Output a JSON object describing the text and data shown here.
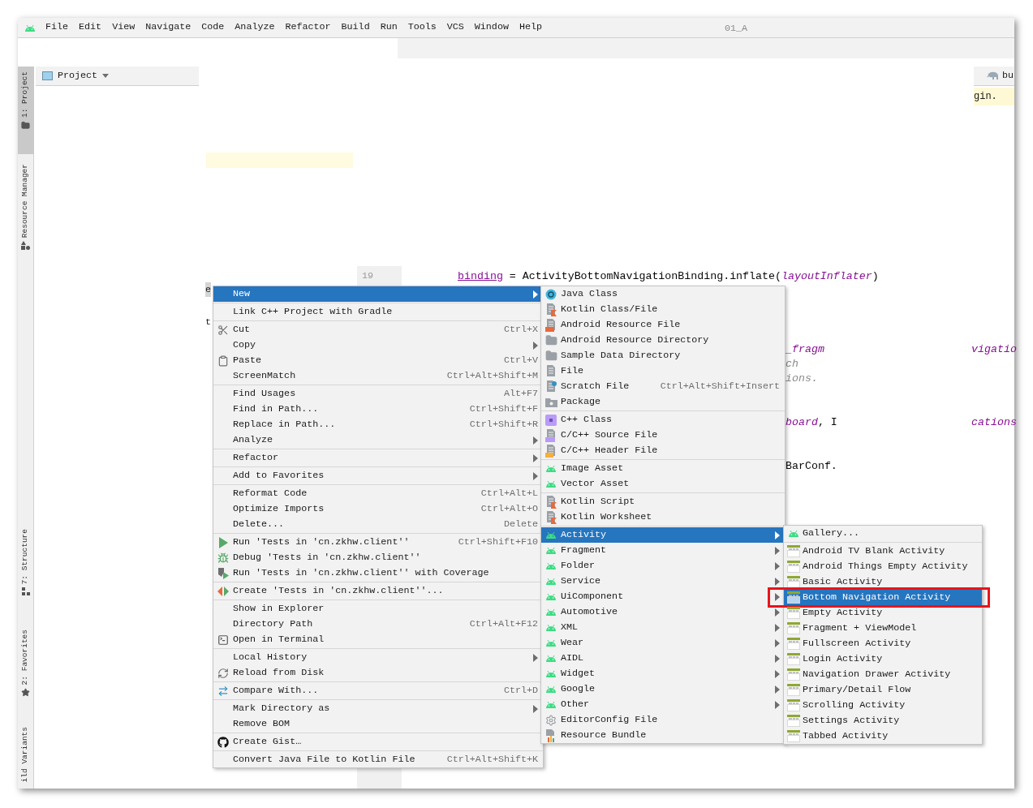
{
  "menu_bar": {
    "items": [
      "File",
      "Edit",
      "View",
      "Navigate",
      "Code",
      "Analyze",
      "Refactor",
      "Build",
      "Run",
      "Tools",
      "VCS",
      "Window",
      "Help"
    ],
    "title_fragment": "01_A"
  },
  "tool_strip": {
    "items": [
      {
        "label": "1: Project",
        "kind": "folder",
        "selected": true
      },
      {
        "label": "Resource Manager",
        "kind": "shapes",
        "selected": false
      },
      {
        "label": "7: Structure",
        "kind": "structure",
        "selected": false
      },
      {
        "label": "2: Favorites",
        "kind": "star",
        "selected": false
      },
      {
        "label": "ild Variants",
        "kind": "none",
        "selected": false
      }
    ]
  },
  "project_panel": {
    "title": "Project",
    "tree_fragments": [
      "e",
      "t"
    ]
  },
  "editor": {
    "tab_fragment": "bu",
    "banner_fragment": "gin.",
    "line_number": "19",
    "code_line": [
      {
        "text": "binding",
        "kind": "property"
      },
      {
        "text": " = ActivityBottomNavigationBinding.inflate(",
        "kind": "plain"
      },
      {
        "text": "layoutInflater",
        "kind": "param"
      },
      {
        "text": ")",
        "kind": "plain"
      }
    ],
    "fragments": [
      [
        {
          "text": "_fragm",
          "kind": "param"
        }
      ],
      [
        {
          "text": "vigatio",
          "kind": "param"
        }
      ],
      [
        {
          "text": "ch",
          "kind": "comment"
        }
      ],
      [
        {
          "text": "ions.",
          "kind": "comment"
        }
      ],
      [
        {
          "text": "board",
          "kind": "param"
        },
        {
          "text": ", I",
          "kind": "plain"
        }
      ],
      [
        {
          "text": "cations",
          "kind": "param"
        }
      ],
      [
        {
          "text": "BarConf.",
          "kind": "plain"
        }
      ]
    ]
  },
  "context_menu": {
    "groups": [
      [
        {
          "label": "New",
          "kind": "none",
          "submenu": true,
          "selected": true
        }
      ],
      [
        {
          "label": "Link C++ Project with Gradle",
          "kind": "none",
          "submenu": false,
          "selected": false
        }
      ],
      [
        {
          "label": "Cut",
          "shortcut": "Ctrl+X",
          "kind": "cut",
          "submenu": false,
          "selected": false
        },
        {
          "label": "Copy",
          "kind": "none",
          "submenu": true,
          "selected": false
        },
        {
          "label": "Paste",
          "shortcut": "Ctrl+V",
          "kind": "paste",
          "submenu": false,
          "selected": false
        },
        {
          "label": "ScreenMatch",
          "shortcut": "Ctrl+Alt+Shift+M",
          "kind": "none",
          "submenu": false,
          "selected": false
        }
      ],
      [
        {
          "label": "Find Usages",
          "shortcut": "Alt+F7",
          "kind": "none",
          "submenu": false,
          "selected": false
        },
        {
          "label": "Find in Path...",
          "shortcut": "Ctrl+Shift+F",
          "kind": "none",
          "submenu": false,
          "selected": false
        },
        {
          "label": "Replace in Path...",
          "shortcut": "Ctrl+Shift+R",
          "kind": "none",
          "submenu": false,
          "selected": false
        },
        {
          "label": "Analyze",
          "kind": "none",
          "submenu": true,
          "selected": false
        }
      ],
      [
        {
          "label": "Refactor",
          "kind": "none",
          "submenu": true,
          "selected": false
        }
      ],
      [
        {
          "label": "Add to Favorites",
          "kind": "none",
          "submenu": true,
          "selected": false
        }
      ],
      [
        {
          "label": "Reformat Code",
          "shortcut": "Ctrl+Alt+L",
          "kind": "none",
          "submenu": false,
          "selected": false
        },
        {
          "label": "Optimize Imports",
          "shortcut": "Ctrl+Alt+O",
          "kind": "none",
          "submenu": false,
          "selected": false
        },
        {
          "label": "Delete...",
          "shortcut": "Delete",
          "kind": "none",
          "submenu": false,
          "selected": false
        }
      ],
      [
        {
          "label": "Run 'Tests in 'cn.zkhw.client''",
          "shortcut": "Ctrl+Shift+F10",
          "kind": "run",
          "submenu": false,
          "selected": false
        },
        {
          "label": "Debug 'Tests in 'cn.zkhw.client''",
          "kind": "debug",
          "submenu": false,
          "selected": false
        },
        {
          "label": "Run 'Tests in 'cn.zkhw.client'' with Coverage",
          "kind": "coverage",
          "submenu": false,
          "selected": false
        }
      ],
      [
        {
          "label": "Create 'Tests in 'cn.zkhw.client''...",
          "kind": "create-test",
          "submenu": false,
          "selected": false
        }
      ],
      [
        {
          "label": "Show in Explorer",
          "kind": "none",
          "submenu": false,
          "selected": false
        },
        {
          "label": "Directory Path",
          "shortcut": "Ctrl+Alt+F12",
          "kind": "none",
          "submenu": false,
          "selected": false
        },
        {
          "label": "Open in Terminal",
          "kind": "terminal",
          "submenu": false,
          "selected": false
        }
      ],
      [
        {
          "label": "Local History",
          "kind": "none",
          "submenu": true,
          "selected": false
        },
        {
          "label": "Reload from Disk",
          "kind": "reload",
          "submenu": false,
          "selected": false
        }
      ],
      [
        {
          "label": "Compare With...",
          "shortcut": "Ctrl+D",
          "kind": "compare",
          "submenu": false,
          "selected": false
        }
      ],
      [
        {
          "label": "Mark Directory as",
          "kind": "none",
          "submenu": true,
          "selected": false
        },
        {
          "label": "Remove BOM",
          "kind": "none",
          "submenu": false,
          "selected": false
        }
      ],
      [
        {
          "label": "Create Gist…",
          "kind": "github",
          "submenu": false,
          "selected": false
        }
      ],
      [
        {
          "label": "Convert Java File to Kotlin File",
          "shortcut": "Ctrl+Alt+Shift+K",
          "kind": "none",
          "submenu": false,
          "selected": false
        }
      ]
    ]
  },
  "new_submenu": {
    "groups": [
      [
        {
          "label": "Java Class",
          "kind": "java-class",
          "submenu": false,
          "selected": false
        },
        {
          "label": "Kotlin Class/File",
          "kind": "kotlin-file",
          "submenu": false,
          "selected": false
        },
        {
          "label": "Android Resource File",
          "kind": "resource-file",
          "submenu": false,
          "selected": false
        },
        {
          "label": "Android Resource Directory",
          "kind": "folder",
          "submenu": false,
          "selected": false
        },
        {
          "label": "Sample Data Directory",
          "kind": "folder",
          "submenu": false,
          "selected": false
        },
        {
          "label": "File",
          "kind": "file",
          "submenu": false,
          "selected": false
        },
        {
          "label": "Scratch File",
          "shortcut": "Ctrl+Alt+Shift+Insert",
          "kind": "scratch",
          "submenu": false,
          "selected": false
        },
        {
          "label": "Package",
          "kind": "package",
          "submenu": false,
          "selected": false
        }
      ],
      [
        {
          "label": "C++ Class",
          "kind": "cpp-class",
          "submenu": false,
          "selected": false
        },
        {
          "label": "C/C++ Source File",
          "kind": "cpp-source",
          "submenu": false,
          "selected": false
        },
        {
          "label": "C/C++ Header File",
          "kind": "cpp-header",
          "submenu": false,
          "selected": false
        }
      ],
      [
        {
          "label": "Image Asset",
          "kind": "android",
          "submenu": false,
          "selected": false
        },
        {
          "label": "Vector Asset",
          "kind": "android",
          "submenu": false,
          "selected": false
        }
      ],
      [
        {
          "label": "Kotlin Script",
          "kind": "kotlin-file",
          "submenu": false,
          "selected": false
        },
        {
          "label": "Kotlin Worksheet",
          "kind": "kotlin-file",
          "submenu": false,
          "selected": false
        }
      ],
      [
        {
          "label": "Activity",
          "kind": "android",
          "submenu": true,
          "selected": true
        },
        {
          "label": "Fragment",
          "kind": "android",
          "submenu": true,
          "selected": false
        },
        {
          "label": "Folder",
          "kind": "android",
          "submenu": true,
          "selected": false
        },
        {
          "label": "Service",
          "kind": "android",
          "submenu": true,
          "selected": false
        },
        {
          "label": "UiComponent",
          "kind": "android",
          "submenu": true,
          "selected": false
        },
        {
          "label": "Automotive",
          "kind": "android",
          "submenu": true,
          "selected": false
        },
        {
          "label": "XML",
          "kind": "android",
          "submenu": true,
          "selected": false
        },
        {
          "label": "Wear",
          "kind": "android",
          "submenu": true,
          "selected": false
        },
        {
          "label": "AIDL",
          "kind": "android",
          "submenu": true,
          "selected": false
        },
        {
          "label": "Widget",
          "kind": "android",
          "submenu": true,
          "selected": false
        },
        {
          "label": "Google",
          "kind": "android",
          "submenu": true,
          "selected": false
        },
        {
          "label": "Other",
          "kind": "android",
          "submenu": true,
          "selected": false
        },
        {
          "label": "EditorConfig File",
          "kind": "gear",
          "submenu": false,
          "selected": false
        },
        {
          "label": "Resource Bundle",
          "kind": "bundle",
          "submenu": false,
          "selected": false
        }
      ]
    ]
  },
  "activity_submenu": {
    "groups": [
      [
        {
          "label": "Gallery...",
          "kind": "android",
          "selected": false,
          "highlighted": false
        }
      ],
      [
        {
          "label": "Android TV Blank Activity",
          "kind": "template",
          "selected": false,
          "highlighted": false
        },
        {
          "label": "Android Things Empty Activity",
          "kind": "template",
          "selected": false,
          "highlighted": false
        },
        {
          "label": "Basic Activity",
          "kind": "template",
          "selected": false,
          "highlighted": false
        },
        {
          "label": "Bottom Navigation Activity",
          "kind": "template",
          "selected": true,
          "highlighted": true
        },
        {
          "label": "Empty Activity",
          "kind": "template",
          "selected": false,
          "highlighted": false
        },
        {
          "label": "Fragment + ViewModel",
          "kind": "template",
          "selected": false,
          "highlighted": false
        },
        {
          "label": "Fullscreen Activity",
          "kind": "template",
          "selected": false,
          "highlighted": false
        },
        {
          "label": "Login Activity",
          "kind": "template",
          "selected": false,
          "highlighted": false
        },
        {
          "label": "Navigation Drawer Activity",
          "kind": "template",
          "selected": false,
          "highlighted": false
        },
        {
          "label": "Primary/Detail Flow",
          "kind": "template",
          "selected": false,
          "highlighted": false
        },
        {
          "label": "Scrolling Activity",
          "kind": "template",
          "selected": false,
          "highlighted": false
        },
        {
          "label": "Settings Activity",
          "kind": "template",
          "selected": false,
          "highlighted": false
        },
        {
          "label": "Tabbed Activity",
          "kind": "template",
          "selected": false,
          "highlighted": false
        }
      ]
    ]
  }
}
